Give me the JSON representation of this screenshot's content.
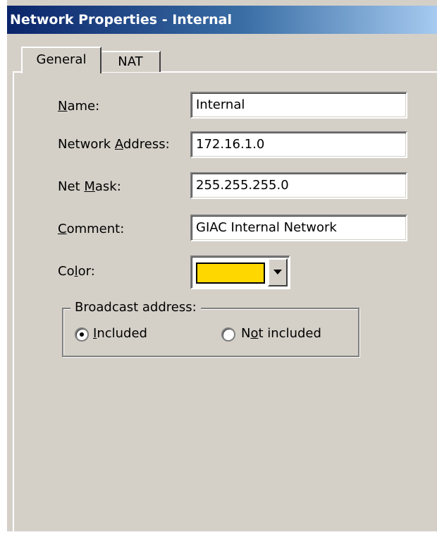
{
  "window": {
    "title": "Network Properties - Internal"
  },
  "tabs": [
    {
      "label": "General",
      "active": true
    },
    {
      "label": "NAT",
      "active": false
    }
  ],
  "form": {
    "name": {
      "label_pre": "",
      "label_key": "N",
      "label_post": "ame:",
      "value": "Internal"
    },
    "network_address": {
      "label_pre": "Network ",
      "label_key": "A",
      "label_post": "ddress:",
      "value": "172.16.1.0"
    },
    "net_mask": {
      "label_pre": "Net ",
      "label_key": "M",
      "label_post": "ask:",
      "value": "255.255.255.0"
    },
    "comment": {
      "label_pre": "",
      "label_key": "C",
      "label_post": "omment:",
      "value": "GIAC Internal Network"
    },
    "color": {
      "label_pre": "Co",
      "label_key": "l",
      "label_post": "or:",
      "value_hex": "#ffd700"
    }
  },
  "broadcast": {
    "legend": "Broadcast address:",
    "options": [
      {
        "label_pre": "",
        "label_key": "I",
        "label_post": "ncluded",
        "selected": true
      },
      {
        "label_pre": "N",
        "label_key": "o",
        "label_post": "t included",
        "selected": false
      }
    ]
  },
  "colors": {
    "dialog_bg": "#d4d0c8",
    "title_start": "#0a246a",
    "title_end": "#a6caf0",
    "color_swatch": "#ffd700"
  }
}
